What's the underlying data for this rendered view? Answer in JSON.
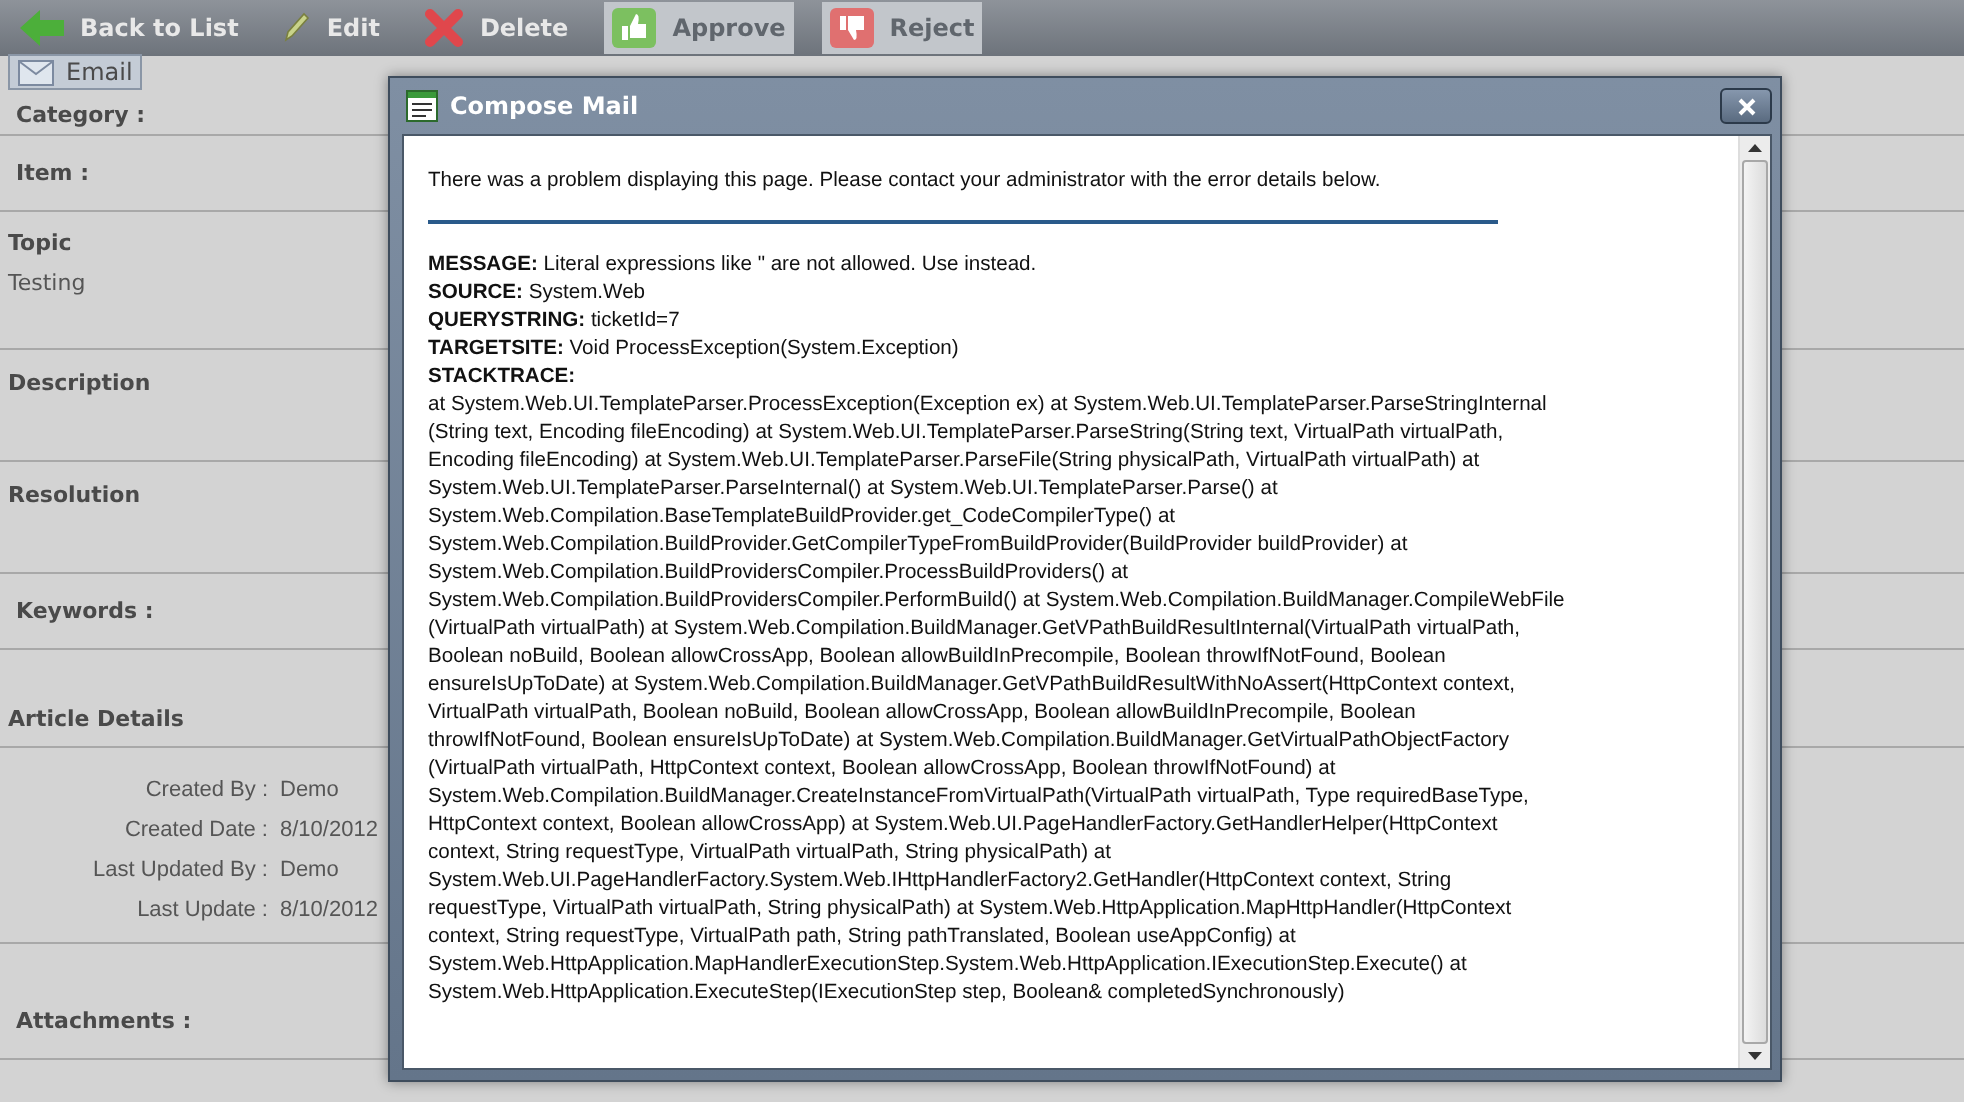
{
  "toolbar": [
    {
      "label": "Back to List",
      "kind": "back",
      "disabled": false
    },
    {
      "label": "Edit",
      "kind": "edit",
      "disabled": false
    },
    {
      "label": "Delete",
      "kind": "delete",
      "disabled": false
    },
    {
      "label": "Approve",
      "kind": "approve",
      "disabled": true
    },
    {
      "label": "Reject",
      "kind": "reject",
      "disabled": true
    }
  ],
  "email_tab": {
    "label": "Email"
  },
  "sections": [
    {
      "kind": "field",
      "label": "Category :"
    },
    {
      "kind": "field",
      "label": "Item :"
    },
    {
      "kind": "text",
      "label": "Topic",
      "value": "Testing"
    },
    {
      "kind": "text",
      "label": "Description"
    },
    {
      "kind": "text",
      "label": "Resolution"
    },
    {
      "kind": "field",
      "label": "Keywords :"
    },
    {
      "kind": "details",
      "label": "Article Details",
      "rows": [
        {
          "label": "Created By :",
          "value": "Demo"
        },
        {
          "label": "Created Date :",
          "value": "8/10/2012"
        },
        {
          "label": "Last Updated By :",
          "value": "Demo"
        },
        {
          "label": "Last Update :",
          "value": "8/10/2012"
        }
      ]
    },
    {
      "kind": "field",
      "label": "Attachments :"
    }
  ],
  "dialog": {
    "title": "Compose Mail",
    "intro": "There was a problem displaying this page. Please contact your administrator with the error details below.",
    "fields": [
      "**MESSAGE:** Literal expressions like \" are not allowed. Use instead.",
      "**SOURCE:** System.Web",
      "**QUERYSTRING:** ticketId=7",
      "**TARGETSITE:** Void ProcessException(System.Exception)"
    ],
    "stack_label": "STACKTRACE:",
    "stacktrace": "at System.Web.UI.TemplateParser.ProcessException(Exception ex) at System.Web.UI.TemplateParser.ParseStringInternal\n(String text, Encoding fileEncoding) at System.Web.UI.TemplateParser.ParseString(String text, VirtualPath virtualPath,\nEncoding fileEncoding) at System.Web.UI.TemplateParser.ParseFile(String physicalPath, VirtualPath virtualPath) at\nSystem.Web.UI.TemplateParser.ParseInternal() at System.Web.UI.TemplateParser.Parse() at\nSystem.Web.Compilation.BaseTemplateBuildProvider.get_CodeCompilerType() at\nSystem.Web.Compilation.BuildProvider.GetCompilerTypeFromBuildProvider(BuildProvider buildProvider) at\nSystem.Web.Compilation.BuildProvidersCompiler.ProcessBuildProviders() at\nSystem.Web.Compilation.BuildProvidersCompiler.PerformBuild() at System.Web.Compilation.BuildManager.CompileWebFile\n(VirtualPath virtualPath) at System.Web.Compilation.BuildManager.GetVPathBuildResultInternal(VirtualPath virtualPath,\nBoolean noBuild, Boolean allowCrossApp, Boolean allowBuildInPrecompile, Boolean throwIfNotFound, Boolean\nensureIsUpToDate) at System.Web.Compilation.BuildManager.GetVPathBuildResultWithNoAssert(HttpContext context,\nVirtualPath virtualPath, Boolean noBuild, Boolean allowCrossApp, Boolean allowBuildInPrecompile, Boolean\nthrowIfNotFound, Boolean ensureIsUpToDate) at System.Web.Compilation.BuildManager.GetVirtualPathObjectFactory\n(VirtualPath virtualPath, HttpContext context, Boolean allowCrossApp, Boolean throwIfNotFound) at\nSystem.Web.Compilation.BuildManager.CreateInstanceFromVirtualPath(VirtualPath virtualPath, Type requiredBaseType,\nHttpContext context, Boolean allowCrossApp) at System.Web.UI.PageHandlerFactory.GetHandlerHelper(HttpContext\ncontext, String requestType, VirtualPath virtualPath, String physicalPath) at\nSystem.Web.UI.PageHandlerFactory.System.Web.IHttpHandlerFactory2.GetHandler(HttpContext context, String\nrequestType, VirtualPath virtualPath, String physicalPath) at System.Web.HttpApplication.MapHttpHandler(HttpContext\ncontext, String requestType, VirtualPath path, String pathTranslated, Boolean useAppConfig) at\nSystem.Web.HttpApplication.MapHandlerExecutionStep.System.Web.HttpApplication.IExecutionStep.Execute() at\nSystem.Web.HttpApplication.ExecuteStep(IExecutionStep step, Boolean& completedSynchronously)"
  }
}
